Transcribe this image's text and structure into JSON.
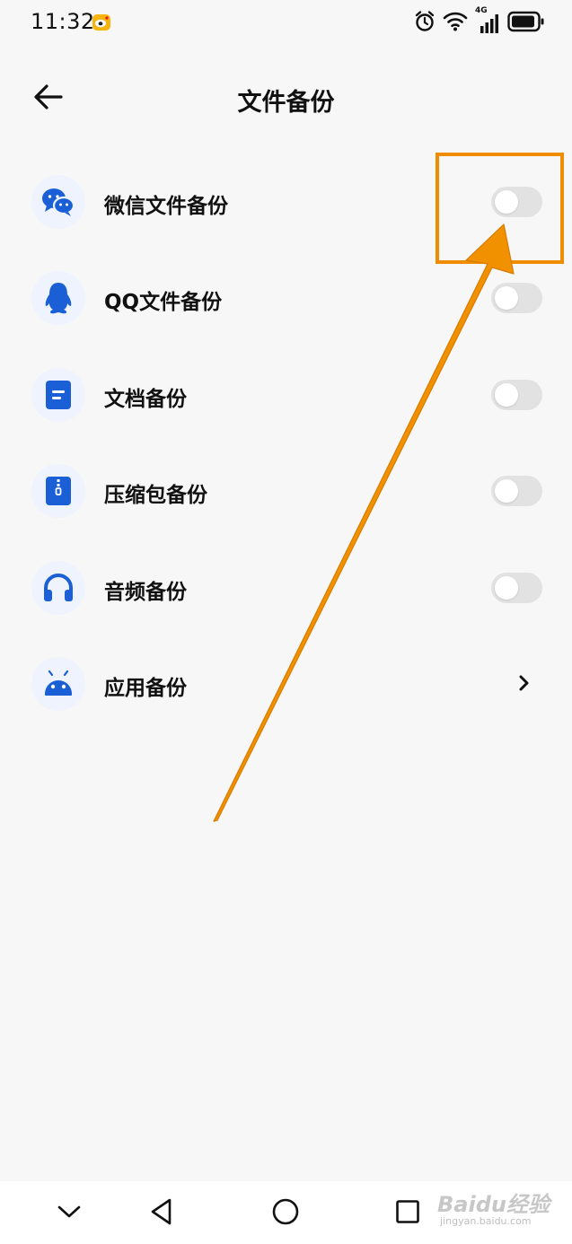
{
  "status_bar": {
    "time": "11:32",
    "network": "4G",
    "icons": [
      "weibo-icon",
      "alarm-icon",
      "wifi-icon",
      "signal-icon",
      "battery-icon"
    ]
  },
  "header": {
    "title": "文件备份",
    "back_icon": "arrow-left-icon"
  },
  "items": [
    {
      "label": "微信文件备份",
      "icon": "wechat-icon",
      "control": "toggle",
      "enabled": false
    },
    {
      "label": "QQ文件备份",
      "icon": "qq-penguin-icon",
      "control": "toggle",
      "enabled": false
    },
    {
      "label": "文档备份",
      "icon": "document-icon",
      "control": "toggle",
      "enabled": false
    },
    {
      "label": "压缩包备份",
      "icon": "zip-archive-icon",
      "control": "toggle",
      "enabled": false
    },
    {
      "label": "音频备份",
      "icon": "headphones-icon",
      "control": "toggle",
      "enabled": false
    },
    {
      "label": "应用备份",
      "icon": "android-icon",
      "control": "chevron"
    }
  ],
  "nav_bar": {
    "icons": [
      "chevron-down-icon",
      "back-triangle-icon",
      "home-circle-icon",
      "recents-square-icon"
    ]
  },
  "watermark": {
    "brand": "Baidu经验",
    "sub": "jingyan.baidu.com"
  },
  "colors": {
    "background": "#f7f7f7",
    "icon_blue": "#1a5fd6",
    "icon_bg": "#eef3fd",
    "toggle_off": "#e2e2e2",
    "annotation_orange": "#f08c00"
  }
}
